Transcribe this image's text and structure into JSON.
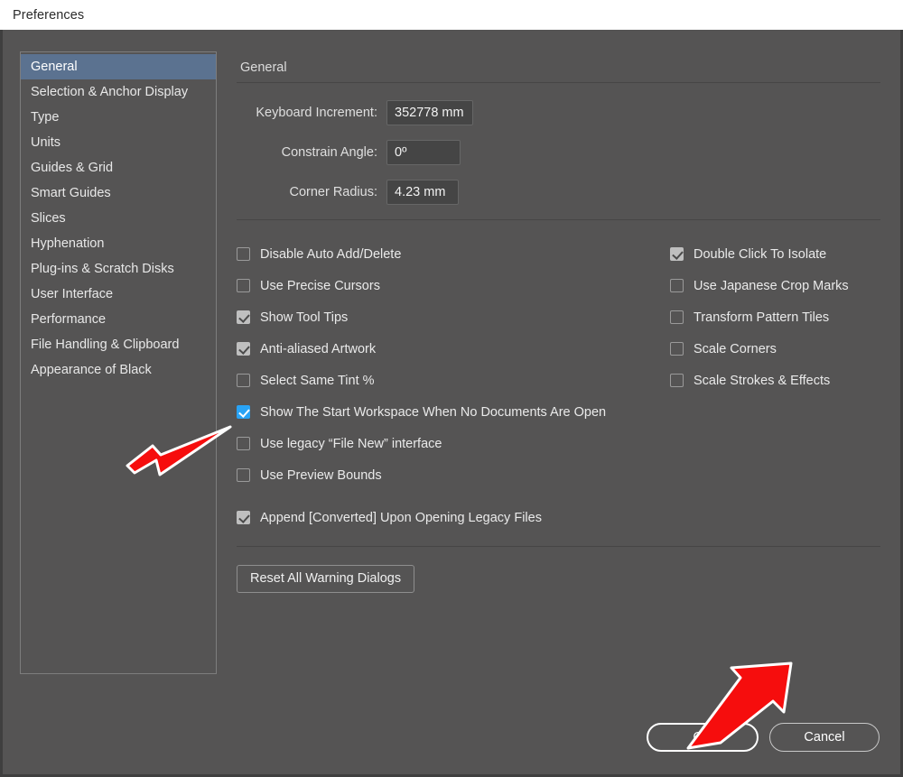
{
  "window": {
    "title": "Preferences"
  },
  "sidebar": {
    "items": [
      {
        "label": "General",
        "selected": true
      },
      {
        "label": "Selection & Anchor Display",
        "selected": false
      },
      {
        "label": "Type",
        "selected": false
      },
      {
        "label": "Units",
        "selected": false
      },
      {
        "label": "Guides & Grid",
        "selected": false
      },
      {
        "label": "Smart Guides",
        "selected": false
      },
      {
        "label": "Slices",
        "selected": false
      },
      {
        "label": "Hyphenation",
        "selected": false
      },
      {
        "label": "Plug-ins & Scratch Disks",
        "selected": false
      },
      {
        "label": "User Interface",
        "selected": false
      },
      {
        "label": "Performance",
        "selected": false
      },
      {
        "label": "File Handling & Clipboard",
        "selected": false
      },
      {
        "label": "Appearance of Black",
        "selected": false
      }
    ]
  },
  "main": {
    "section_title": "General",
    "fields": [
      {
        "label": "Keyboard Increment:",
        "value": "352778 mm"
      },
      {
        "label": "Constrain Angle:",
        "value": "0º"
      },
      {
        "label": "Corner Radius:",
        "value": "4.23 mm"
      }
    ],
    "checkboxes_left": [
      {
        "label": "Disable Auto Add/Delete",
        "checked": false,
        "highlight": false
      },
      {
        "label": "Use Precise Cursors",
        "checked": false,
        "highlight": false
      },
      {
        "label": "Show Tool Tips",
        "checked": true,
        "highlight": false
      },
      {
        "label": "Anti-aliased Artwork",
        "checked": true,
        "highlight": false
      },
      {
        "label": "Select Same Tint %",
        "checked": false,
        "highlight": false
      },
      {
        "label": "Show The Start Workspace When No Documents Are Open",
        "checked": true,
        "highlight": true
      },
      {
        "label": "Use legacy “File New” interface",
        "checked": false,
        "highlight": false
      },
      {
        "label": "Use Preview Bounds",
        "checked": false,
        "highlight": false
      },
      {
        "label": "Append [Converted] Upon Opening Legacy Files",
        "checked": true,
        "highlight": false
      }
    ],
    "checkboxes_right": [
      {
        "label": "Double Click To Isolate",
        "checked": true,
        "highlight": false
      },
      {
        "label": "Use Japanese Crop Marks",
        "checked": false,
        "highlight": false
      },
      {
        "label": "Transform Pattern Tiles",
        "checked": false,
        "highlight": false
      },
      {
        "label": "Scale Corners",
        "checked": false,
        "highlight": false
      },
      {
        "label": "Scale Strokes & Effects",
        "checked": false,
        "highlight": false
      }
    ],
    "reset_button": "Reset All Warning Dialogs"
  },
  "footer": {
    "ok_label": "OK",
    "cancel_label": "Cancel"
  },
  "annotations": {
    "arrow_color": "#f60d0d",
    "arrow_outline": "#ffffff",
    "arrow_to_checkbox": "arrow-pointing-to-start-workspace-checkbox",
    "arrow_to_ok": "arrow-pointing-to-ok-button"
  },
  "colors": {
    "panel_bg": "#555454",
    "titlebar_bg": "#ffffff",
    "selection_blue": "#5b7290",
    "checkbox_accent": "#29a3f5"
  }
}
